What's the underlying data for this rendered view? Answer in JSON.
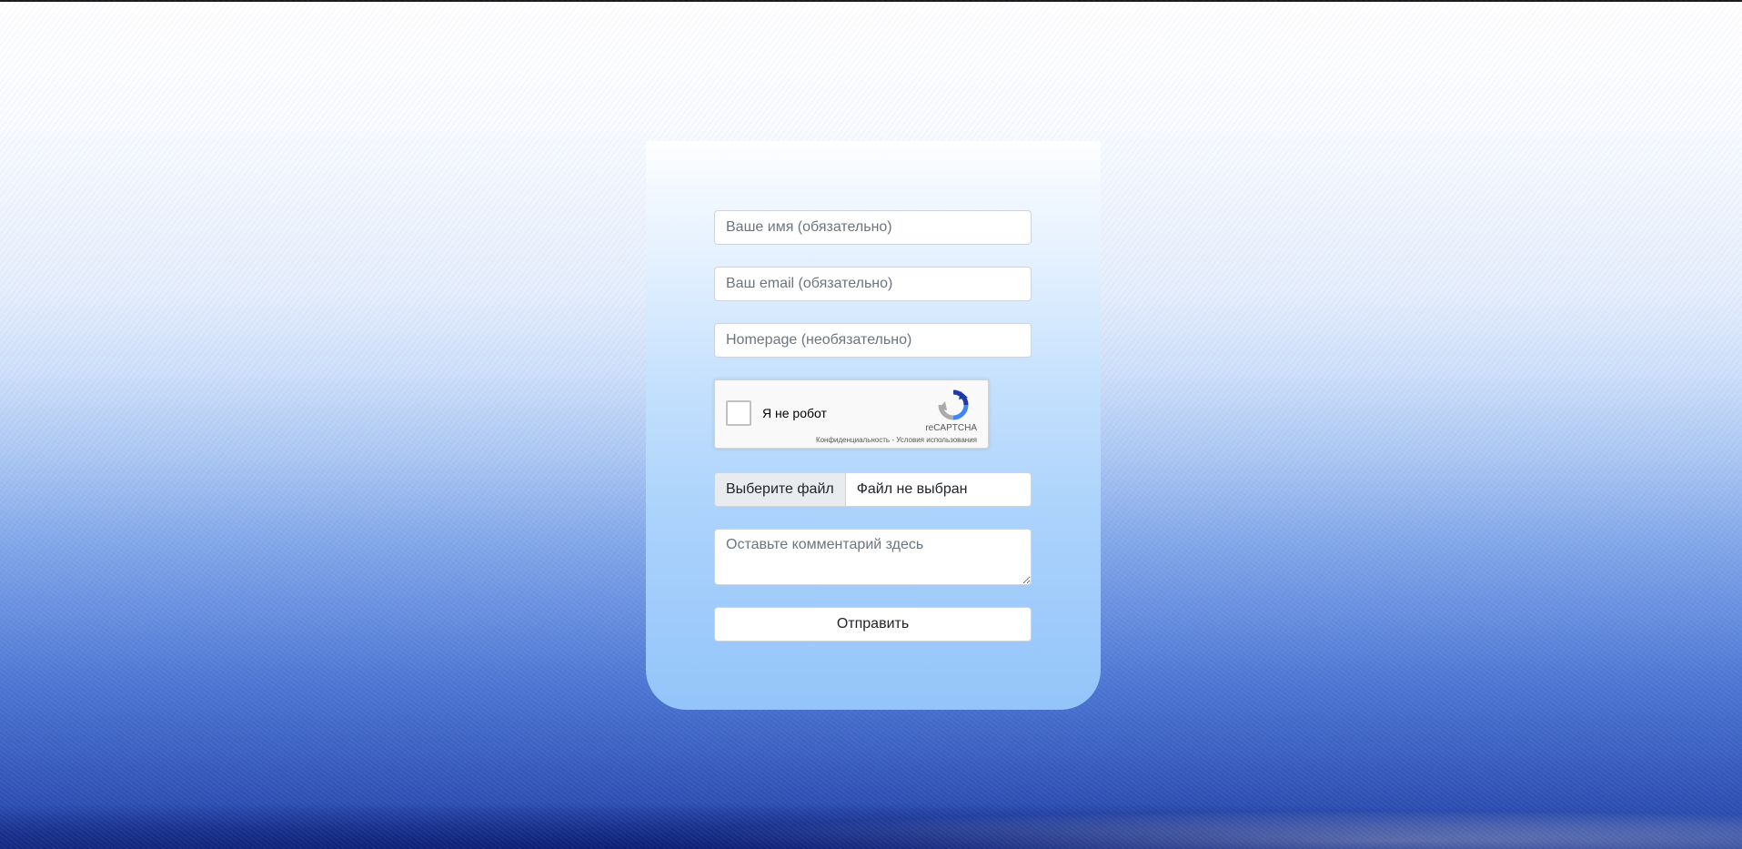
{
  "form": {
    "name_placeholder": "Ваше имя (обязательно)",
    "email_placeholder": "Ваш email (обязательно)",
    "homepage_placeholder": "Homepage (необязательно)",
    "recaptcha": {
      "label": "Я не робот",
      "brand": "reCAPTCHA",
      "privacy_link": "Конфиденциальность",
      "separator": " - ",
      "terms_link": "Условия использования",
      "logo_icon": "recaptcha-logo-icon"
    },
    "file": {
      "button_label": "Выберите файл",
      "status": "Файл не выбран"
    },
    "comment_placeholder": "Оставьте комментарий здесь",
    "submit_label": "Отправить"
  },
  "colors": {
    "card_top": "#e3f0fe",
    "card_bottom": "#93c4fa",
    "background_bottom": "#23409e"
  }
}
